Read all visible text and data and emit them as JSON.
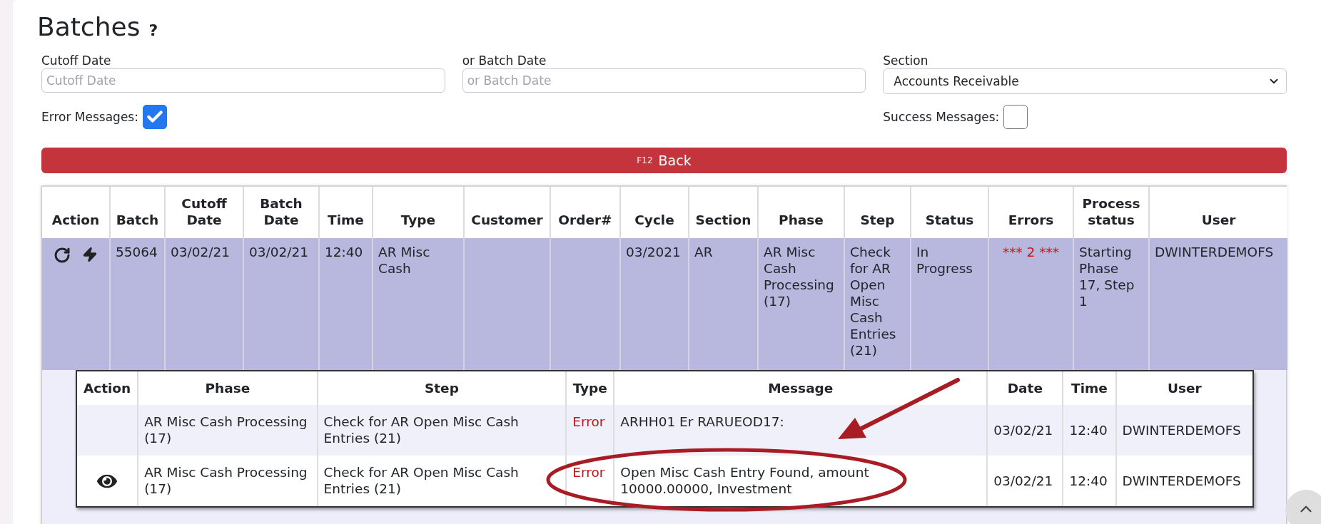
{
  "title": "Batches",
  "help_mark": "?",
  "filters": [
    {
      "label": "Cutoff Date",
      "kind": "input",
      "placeholder": "Cutoff Date"
    },
    {
      "label": "or Batch Date",
      "kind": "input",
      "placeholder": "or Batch Date"
    },
    {
      "label": "Section",
      "kind": "select",
      "value": "Accounts Receivable"
    }
  ],
  "toggles": [
    {
      "label": "Error Messages:",
      "checked": true
    },
    {
      "label": "Success Messages:",
      "checked": false
    }
  ],
  "back_button": {
    "shortcut": "F12",
    "label": "Back"
  },
  "batches": {
    "columns": [
      "Action",
      "Batch",
      "Cutoff Date",
      "Batch Date",
      "Time",
      "Type",
      "Customer",
      "Order#",
      "Cycle",
      "Section",
      "Phase",
      "Step",
      "Status",
      "Errors",
      "Process status",
      "User"
    ],
    "rows": [
      {
        "selected": true,
        "batch": "55064",
        "cutoff_date": "03/02/21",
        "batch_date": "03/02/21",
        "time": "12:40",
        "type": "AR Misc Cash",
        "customer": "",
        "order": "",
        "cycle": "03/2021",
        "section": "AR",
        "phase": "AR Misc Cash Processing (17)",
        "step": "Check for AR Open Misc Cash Entries (21)",
        "status": "In Progress",
        "errors": "*** 2 ***",
        "process_status": "Starting Phase 17, Step 1",
        "user": "DWINTERDEMOFS"
      }
    ]
  },
  "messages": {
    "columns": [
      "Action",
      "Phase",
      "Step",
      "Type",
      "Message",
      "Date",
      "Time",
      "User"
    ],
    "rows": [
      {
        "viewable": false,
        "phase": "AR Misc Cash Processing (17)",
        "step": "Check for AR Open Misc Cash Entries (21)",
        "type": "Error",
        "message": "ARHH01 Er RARUEOD17:",
        "date": "03/02/21",
        "time": "12:40",
        "user": "DWINTERDEMOFS"
      },
      {
        "viewable": true,
        "phase": "AR Misc Cash Processing (17)",
        "step": "Check for AR Open Misc Cash Entries (21)",
        "type": "Error",
        "message": "Open Misc Cash Entry Found, amount 10000.00000, Investment",
        "date": "03/02/21",
        "time": "12:40",
        "user": "DWINTERDEMOFS"
      }
    ]
  }
}
